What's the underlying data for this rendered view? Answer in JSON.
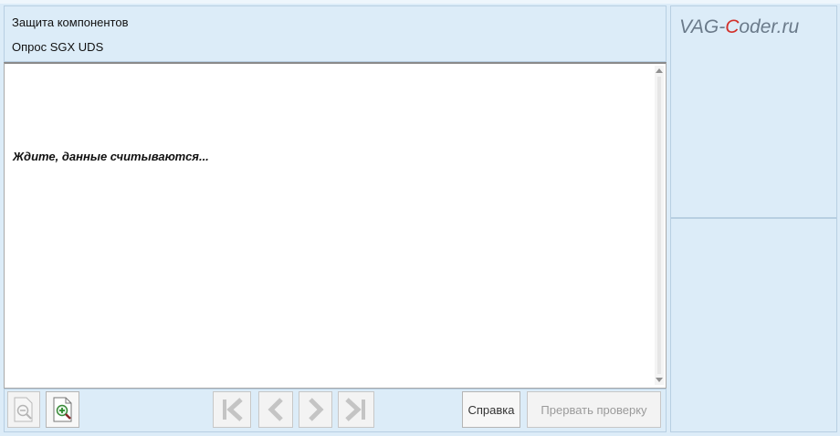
{
  "header": {
    "title": "Защита компонентов",
    "subtitle": "Опрос SGX UDS"
  },
  "content": {
    "message": "Ждите, данные считываются..."
  },
  "toolbar": {
    "help_label": "Справка",
    "abort_label": "Прервать проверку"
  },
  "watermark": {
    "part1": "VAG-",
    "accent": "C",
    "part2": "oder.ru",
    "accent_color": "#d2302a"
  },
  "icons": {
    "zoom_out": "zoom-out-icon",
    "zoom_in": "zoom-in-icon",
    "first": "first-page-icon",
    "prev": "previous-page-icon",
    "next": "next-page-icon",
    "last": "last-page-icon"
  }
}
